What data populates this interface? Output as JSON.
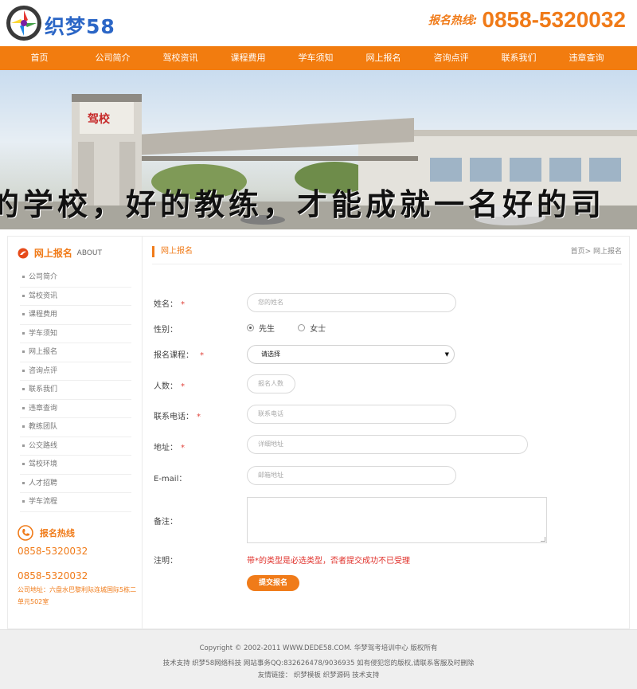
{
  "header": {
    "logo_text": "织梦58",
    "hotline_label": "报名热线:",
    "hotline_number": "0858-5320032"
  },
  "nav": [
    "首页",
    "公司简介",
    "驾校资讯",
    "课程费用",
    "学车须知",
    "网上报名",
    "咨询点评",
    "联系我们",
    "违章查询"
  ],
  "banner": {
    "gate_sign": "驾校",
    "slogan": "的学校，好的教练，才能成就一名好的司"
  },
  "sidebar": {
    "title": "网上报名",
    "title_en": "ABOUT",
    "items": [
      "公司简介",
      "驾校资讯",
      "课程费用",
      "学车须知",
      "网上报名",
      "咨询点评",
      "联系我们",
      "违章查询",
      "教练团队",
      "公交路线",
      "驾校环境",
      "人才招聘",
      "学车流程"
    ],
    "contact_title": "报名热线",
    "contact_phone1": "0858-5320032",
    "contact_phone2": "0858-5320032",
    "contact_address": "公司地址：六盘水巴黎利际连城国际5栋二单元502室"
  },
  "content": {
    "title": "网上报名",
    "breadcrumb": "首页> 网上报名"
  },
  "form": {
    "name_label": "姓名：",
    "name_placeholder": "您的姓名",
    "gender_label": "性别：",
    "gender_male": "先生",
    "gender_female": "女士",
    "course_label": "报名课程：",
    "course_selected": "请选择",
    "count_label": "人数：",
    "count_placeholder": "报名人数",
    "phone_label": "联系电话：",
    "phone_placeholder": "联系电话",
    "address_label": "地址：",
    "address_placeholder": "详细地址",
    "email_label": "E-mail：",
    "email_placeholder": "邮箱地址",
    "remark_label": "备注：",
    "note_label": "注明：",
    "note_text": "带*的类型是必选类型，否者提交成功不已受理",
    "submit_label": "提交报名",
    "required_mark": "*"
  },
  "footer": {
    "line1": "Copyright © 2002-2011 WWW.DEDE58.COM. 华梦驾考培训中心 版权所有",
    "line2": "技术支持 织梦58网络科技 网站事务QQ:832626478/9036935 如有侵犯您的版权,请联系客服及时删除",
    "line3": "友情链接：  织梦模板  织梦源码  技术支持"
  },
  "colors": {
    "accent": "#f27c0f",
    "logo_blue": "#2b66c6",
    "required_red": "#e0443c"
  },
  "icons": [
    "logo-wheel-icon",
    "flame-icon",
    "phone-icon",
    "chevron-down-icon"
  ]
}
